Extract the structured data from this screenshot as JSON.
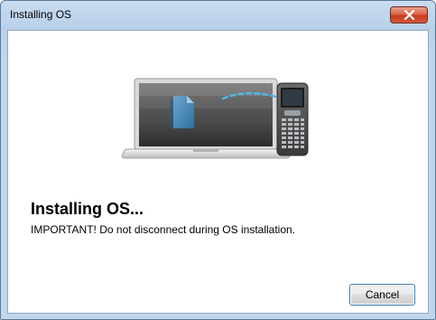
{
  "window": {
    "title": "Installing OS",
    "close_icon": "close-icon"
  },
  "illustration": {
    "laptop_icon": "laptop-icon",
    "document_icon": "document-icon",
    "handheld_icon": "handheld-calculator-icon",
    "connection": "dashed-connection-line"
  },
  "content": {
    "heading": "Installing OS...",
    "message": "IMPORTANT! Do not disconnect during OS installation."
  },
  "buttons": {
    "cancel_label": "Cancel"
  },
  "colors": {
    "title_bar": "#bcd2ea",
    "close_button": "#c7391c",
    "connection_line": "#4fb6e6",
    "cancel_border": "#3c7fb1"
  }
}
